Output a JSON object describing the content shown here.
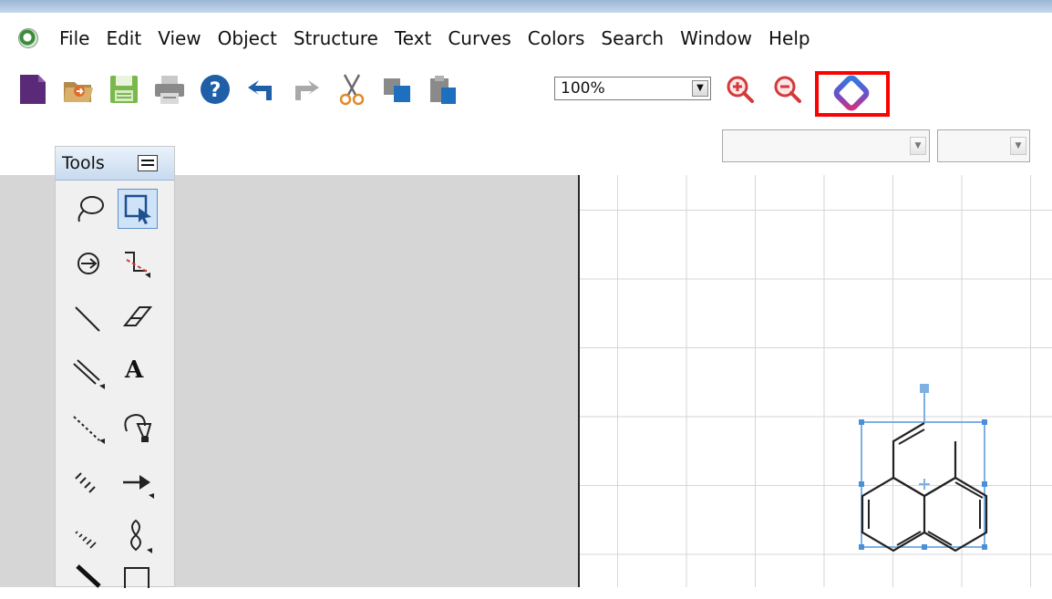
{
  "menubar": {
    "items": [
      {
        "id": "file",
        "label": "File"
      },
      {
        "id": "edit",
        "label": "Edit"
      },
      {
        "id": "view",
        "label": "View"
      },
      {
        "id": "object",
        "label": "Object"
      },
      {
        "id": "structure",
        "label": "Structure"
      },
      {
        "id": "text",
        "label": "Text"
      },
      {
        "id": "curves",
        "label": "Curves"
      },
      {
        "id": "colors",
        "label": "Colors"
      },
      {
        "id": "search",
        "label": "Search"
      },
      {
        "id": "window",
        "label": "Window"
      },
      {
        "id": "help",
        "label": "Help"
      }
    ]
  },
  "toolbar": {
    "zoom_value": "100%",
    "highlighted_button": "add-in-icon",
    "highlight_color": "#ff0000"
  },
  "tools_panel": {
    "title": "Tools",
    "text_tool_label": "A",
    "tools": [
      "lasso-icon",
      "marquee-select-icon",
      "structure-perspective-icon",
      "mass-fragmentation-icon",
      "solid-bond-icon",
      "eraser-icon",
      "multiple-bond-icon",
      "text-tool-icon",
      "dashed-bond-icon",
      "pen-tool-icon",
      "hashed-bond-icon",
      "arrow-tool-icon",
      "hashed-wedge-bond-icon",
      "orbital-tool-icon",
      "bold-bond-icon",
      "rectangle-tool-icon"
    ]
  },
  "colors": {
    "accent": "#4a90d9",
    "selection": "#6aaee8",
    "workspace": "#d6d6d6",
    "grid": "#d6d6d6"
  }
}
